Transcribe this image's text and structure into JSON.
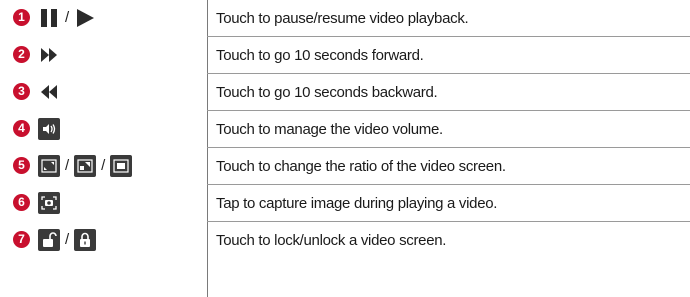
{
  "rows": [
    {
      "num": "1",
      "icons": [
        "pause-icon",
        "play-icon"
      ],
      "desc": "Touch to pause/resume video playback."
    },
    {
      "num": "2",
      "icons": [
        "fast-forward-icon"
      ],
      "desc": "Touch to go 10 seconds forward."
    },
    {
      "num": "3",
      "icons": [
        "rewind-icon"
      ],
      "desc": "Touch to go 10 seconds backward."
    },
    {
      "num": "4",
      "icons": [
        "volume-icon"
      ],
      "desc": "Touch to manage the video volume."
    },
    {
      "num": "5",
      "icons": [
        "ratio-original-icon",
        "ratio-fit-icon",
        "ratio-fill-icon"
      ],
      "desc": "Touch to change the ratio of the video screen."
    },
    {
      "num": "6",
      "icons": [
        "capture-icon"
      ],
      "desc": "Tap to capture image during playing a video."
    },
    {
      "num": "7",
      "icons": [
        "unlock-icon",
        "lock-icon"
      ],
      "desc": "Touch to lock/unlock a video screen."
    }
  ],
  "separator": "/",
  "colors": {
    "badge": "#c8102e",
    "icon_tile": "#3a3a3a"
  }
}
